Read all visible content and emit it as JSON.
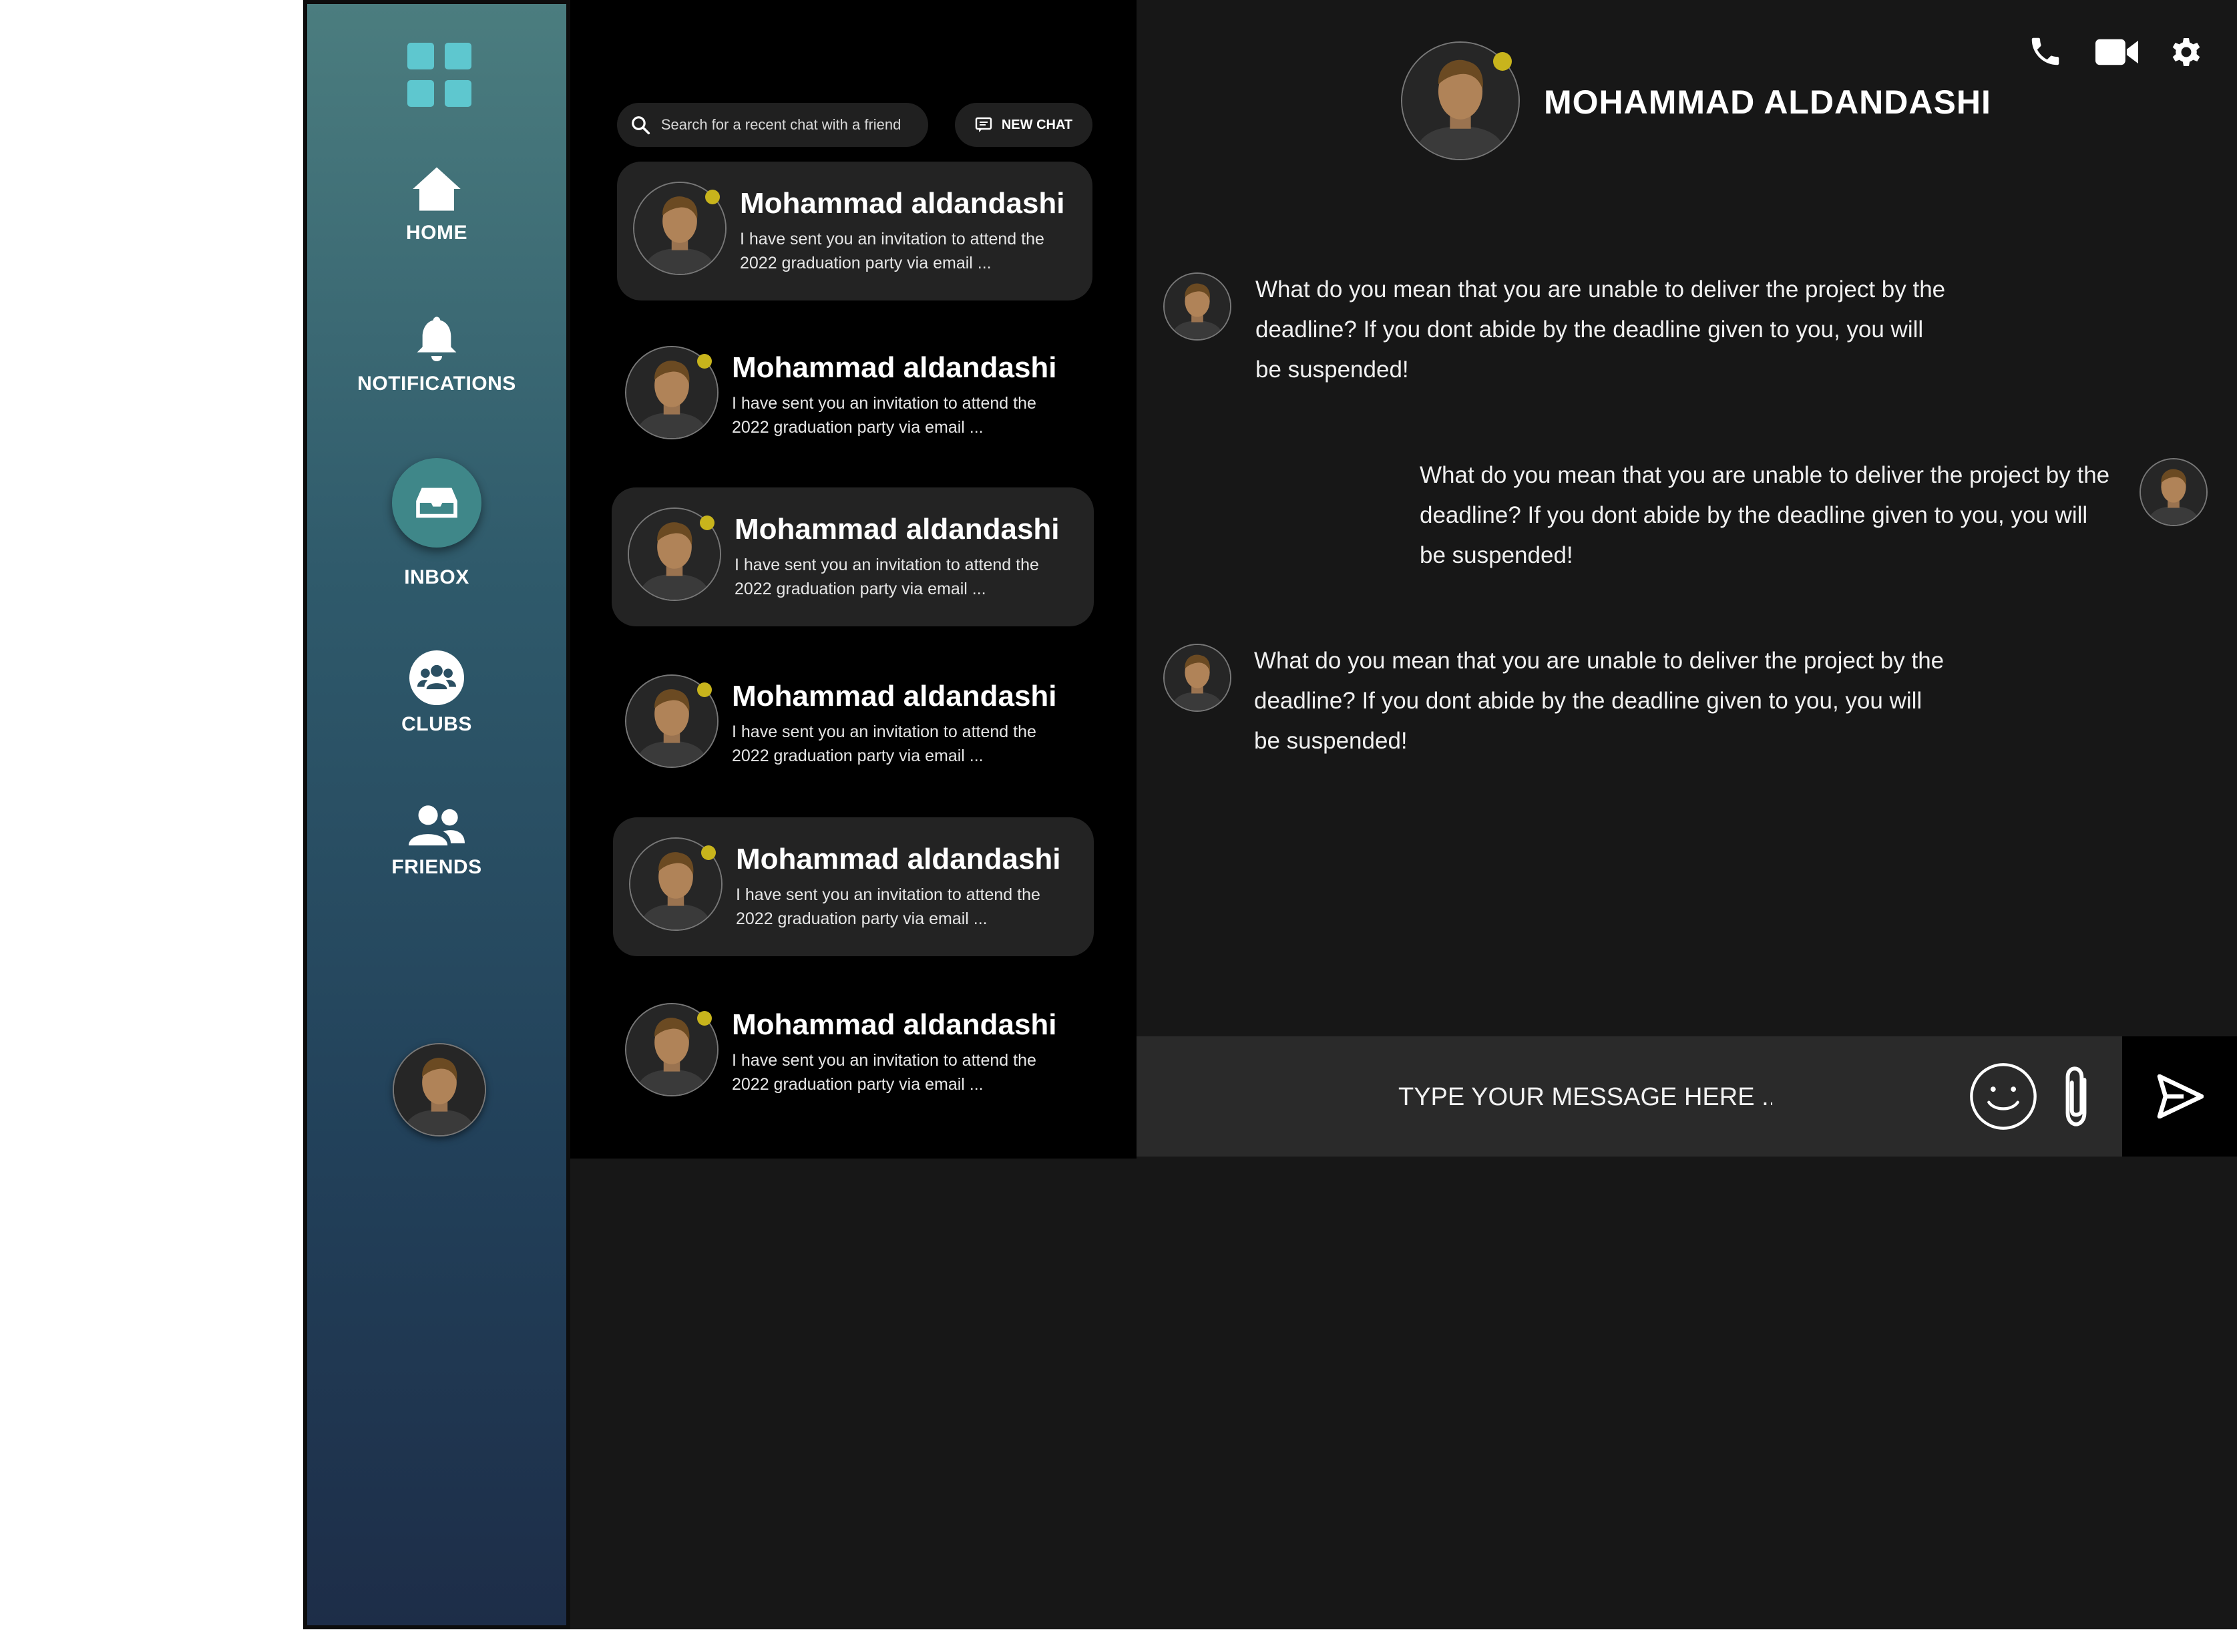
{
  "sidebar": {
    "nav": [
      {
        "label": "HOME",
        "icon": "home-icon"
      },
      {
        "label": "NOTIFICATIONS",
        "icon": "bell-icon"
      },
      {
        "label": "INBOX",
        "icon": "inbox-icon"
      },
      {
        "label": "CLUBS",
        "icon": "clubs-icon"
      },
      {
        "label": "FRIENDS",
        "icon": "friends-icon"
      }
    ]
  },
  "chatlist": {
    "search_placeholder": "Search for a recent chat with a friend",
    "new_chat_label": "NEW CHAT",
    "items": [
      {
        "name": "Mohammad aldandashi",
        "preview": "I have sent you an invitation to attend the 2022 graduation party via email ..."
      },
      {
        "name": "Mohammad aldandashi",
        "preview": "I have sent you an invitation to attend the 2022 graduation party via email ..."
      },
      {
        "name": "Mohammad aldandashi",
        "preview": "I have sent you an invitation to attend the 2022 graduation party via email ..."
      },
      {
        "name": "Mohammad aldandashi",
        "preview": "I have sent you an invitation to attend the 2022 graduation party via email ..."
      },
      {
        "name": "Mohammad aldandashi",
        "preview": "I have sent you an invitation to attend the 2022 graduation party via email ..."
      },
      {
        "name": "Mohammad aldandashi",
        "preview": "I have sent you an invitation to attend the 2022 graduation party via email ..."
      }
    ]
  },
  "conversation": {
    "contact_name": "MOHAMMAD ALDANDASHI",
    "messages": [
      {
        "side": "left",
        "text": "What do you mean that you are unable to deliver the project by the deadline? If you dont abide by the deadline given to you, you will be suspended!"
      },
      {
        "side": "right",
        "text": "What do you mean that you are unable to deliver the project by the deadline? If you dont abide by the deadline given to you, you will be suspended!"
      },
      {
        "side": "left",
        "text": "What do you mean that you are unable to deliver the project by the deadline? If you dont abide by the deadline given to you, you will be suspended!"
      }
    ],
    "composer_placeholder": "TYPE YOUR MESSAGE HERE ....."
  },
  "colors": {
    "accent": "#5ec7cf",
    "online_dot": "#c8b41c",
    "inbox_active": "#3f8789"
  }
}
